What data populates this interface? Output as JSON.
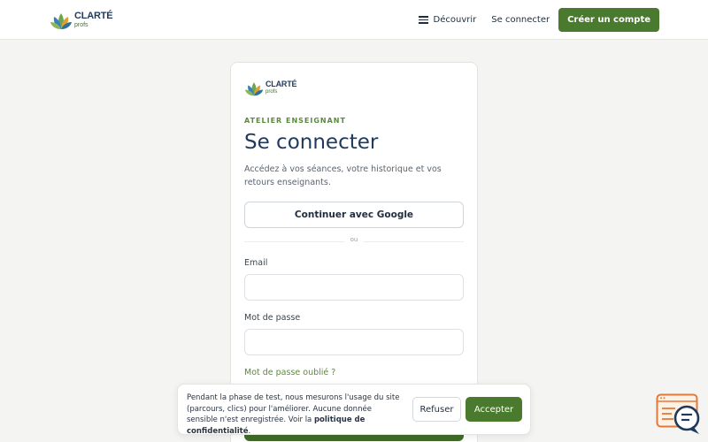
{
  "header": {
    "brand_name": "CLARTÉ",
    "brand_sub": "profs",
    "menu_label": "Découvrir",
    "login_link": "Se connecter",
    "signup_button": "Créer un compte"
  },
  "card": {
    "brand_name": "CLARTÉ",
    "brand_sub": "profs",
    "eyebrow": "ATELIER ENSEIGNANT",
    "title": "Se connecter",
    "subtitle": "Accédez à vos séances, votre historique et vos retours enseignants.",
    "google_button": "Continuer avec Google",
    "divider": "ou",
    "email_label": "Email",
    "email_value": "",
    "password_label": "Mot de passe",
    "password_value": "",
    "forgot_link": "Mot de passe oublié ?"
  },
  "cookie": {
    "text_before": "Pendant la phase de test, nous mesurons l'usage du site (parcours, clics) pour l'améliorer. Aucune donnée sensible n'est enregistrée. Voir la ",
    "policy_link": "politique de confidentialité",
    "text_after": ".",
    "refuse_button": "Refuser",
    "accept_button": "Accepter"
  },
  "colors": {
    "accent": "#4a7a2e",
    "title": "#1f3a5c",
    "link": "#5b8a3a"
  },
  "icons": {
    "brand": "lotus-logo-icon",
    "menu": "hamburger-icon",
    "chat": "chat-support-icon"
  }
}
